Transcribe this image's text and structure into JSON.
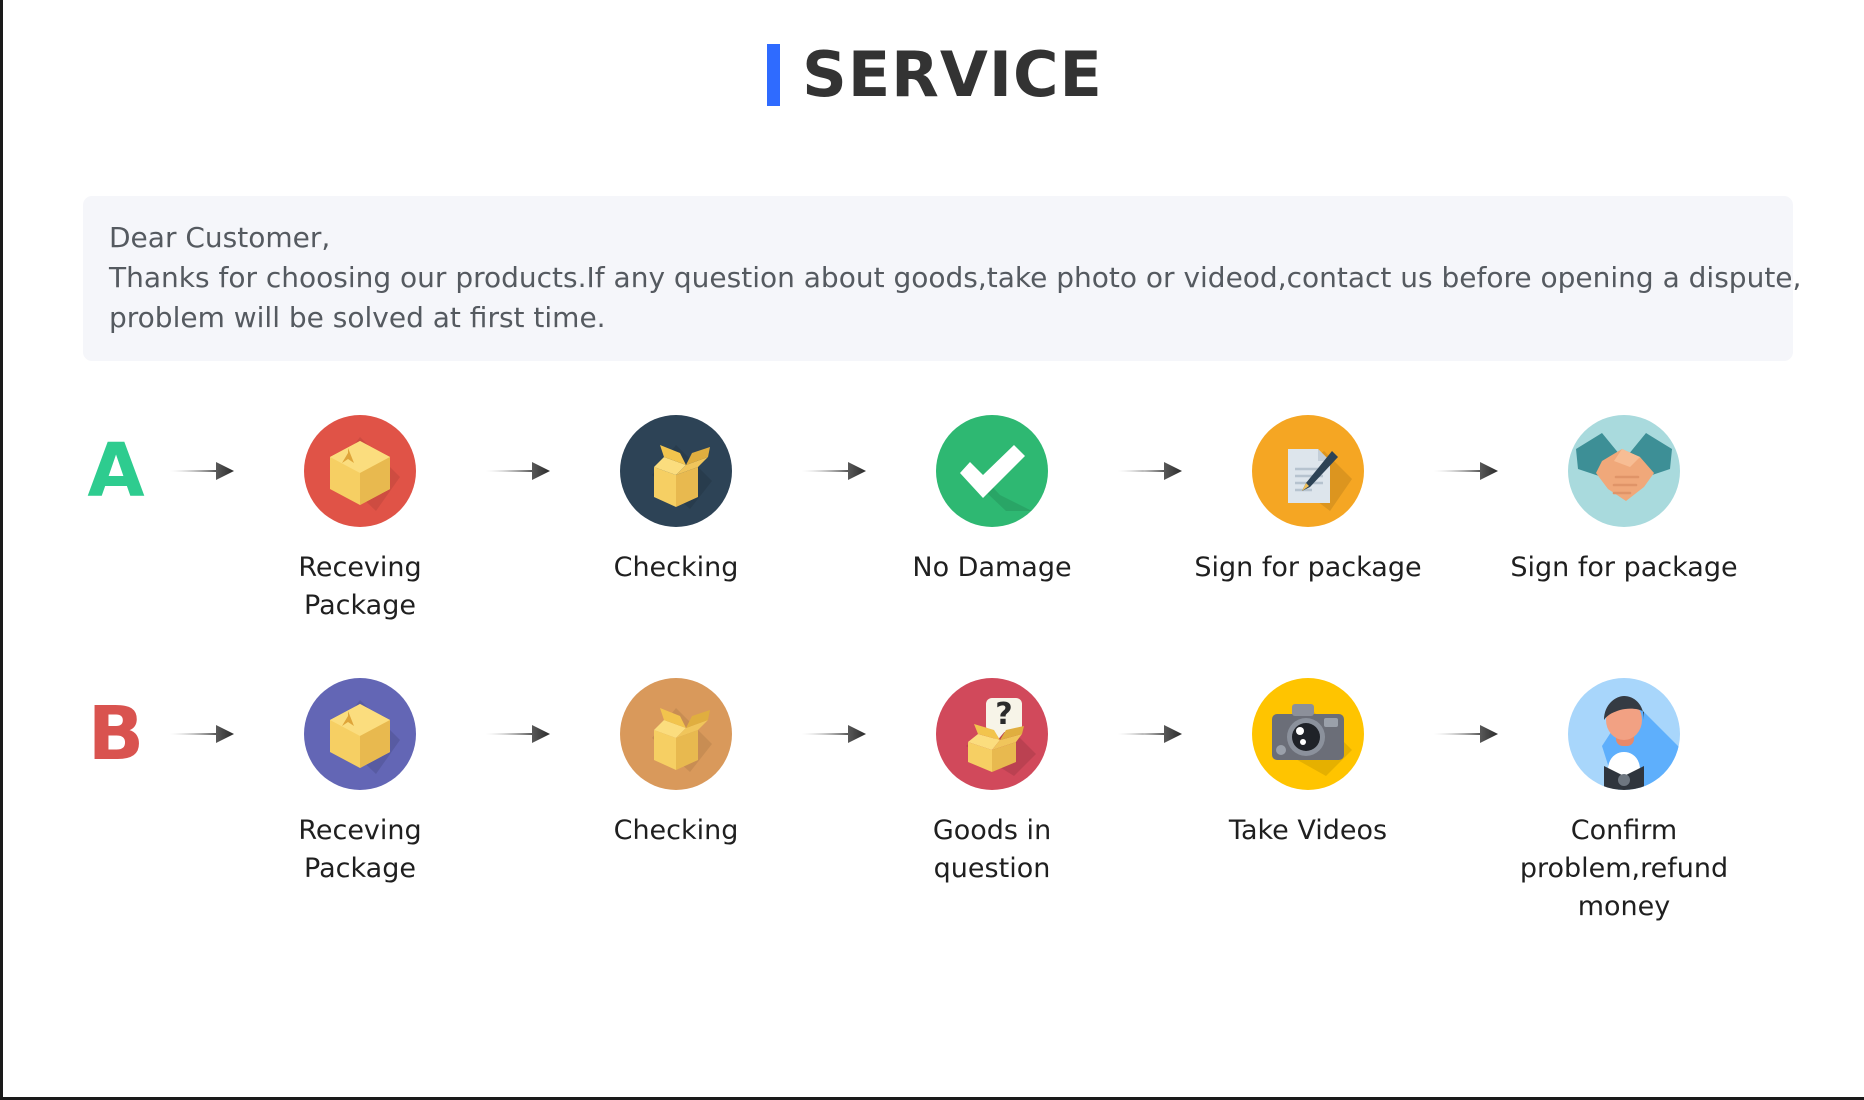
{
  "header": {
    "title": "SERVICE",
    "accent_color": "#2f6bff",
    "title_color": "#333333"
  },
  "notice": {
    "line1": "Dear Customer,",
    "line2": "Thanks for choosing our products.If any question about goods,take photo or videod,contact us before opening a dispute,",
    "line3": "problem will be solved at first time.",
    "background_color": "#f5f6fa",
    "text_color": "#555a60"
  },
  "flows": [
    {
      "letter": "A",
      "letter_color": "#2ecc8f",
      "steps": [
        {
          "label": "Receving Package",
          "icon": "closed-box-icon",
          "circle_color": "#e05347"
        },
        {
          "label": "Checking",
          "icon": "open-box-icon",
          "circle_color": "#2d4356"
        },
        {
          "label": "No Damage",
          "icon": "check-mark-icon",
          "circle_color": "#2eb872"
        },
        {
          "label": "Sign for package",
          "icon": "document-pen-icon",
          "circle_color": "#f5a623"
        },
        {
          "label": "Sign for package",
          "icon": "handshake-icon",
          "circle_color": "#a9dadd"
        }
      ]
    },
    {
      "letter": "B",
      "letter_color": "#d9534f",
      "steps": [
        {
          "label": "Receving Package",
          "icon": "closed-box-icon",
          "circle_color": "#6366b5"
        },
        {
          "label": "Checking",
          "icon": "open-box-icon",
          "circle_color": "#d9995b"
        },
        {
          "label": "Goods in question",
          "icon": "question-box-icon",
          "circle_color": "#d1495b"
        },
        {
          "label": "Take Videos",
          "icon": "camera-icon",
          "circle_color": "#ffc400"
        },
        {
          "label": "Confirm problem,refund money",
          "icon": "support-agent-icon",
          "circle_color": "#a8d6fb"
        }
      ]
    }
  ],
  "arrow": {
    "name": "right-arrow-icon",
    "color": "#3b3b3b"
  }
}
